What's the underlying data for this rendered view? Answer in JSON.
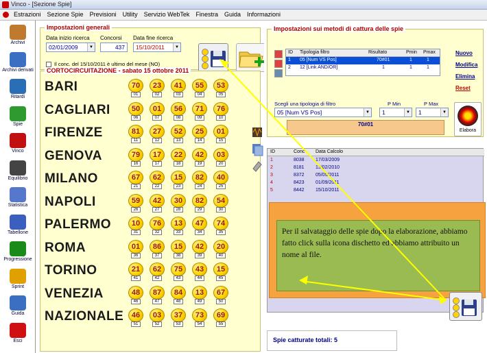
{
  "window": {
    "title": "Vinco - [Sezione Spie]"
  },
  "menu": [
    "Estrazioni",
    "Sezione Spie",
    "Previsioni",
    "Utility",
    "Servizio WebTek",
    "Finestra",
    "Guida",
    "Informazioni"
  ],
  "sidebar": [
    {
      "label": "Archivi",
      "icon": "pencil-icon",
      "color": "#c07a30"
    },
    {
      "label": "Archivi derivati",
      "icon": "document-icon",
      "color": "#3a6fc1"
    },
    {
      "label": "Ritardi",
      "icon": "clock-icon",
      "color": "#2a6fb5"
    },
    {
      "label": "Spie",
      "icon": "flashlight-icon",
      "color": "#2f9a2f"
    },
    {
      "label": "Vinco",
      "icon": "vinco-logo-icon",
      "color": "#c01010"
    },
    {
      "label": "Equilibrio",
      "icon": "scale-icon",
      "color": "#444444"
    },
    {
      "label": "Statistica",
      "icon": "chart-icon",
      "color": "#5577cc"
    },
    {
      "label": "Tabellone",
      "icon": "calendar-icon",
      "color": "#3a5fbf"
    },
    {
      "label": "Progressione",
      "icon": "dollar-icon",
      "color": "#1a8a1a"
    },
    {
      "label": "Sprint",
      "icon": "arrow-icon",
      "color": "#e0a000"
    },
    {
      "label": "Guida",
      "icon": "book-icon",
      "color": "#3a6fc1"
    },
    {
      "label": "Esci",
      "icon": "exit-icon",
      "color": "#d01010"
    }
  ],
  "general": {
    "title": "Impostazioni generali",
    "start_label": "Data inizio ricerca",
    "start_value": "02/01/2009",
    "conc_label": "Concorsi",
    "conc_value": "437",
    "end_label": "Data fine ricerca",
    "end_value": "15/10/2011",
    "checkbox_label": "Il conc. del 15/10/2011 è ultimo del mese (NO)"
  },
  "results": {
    "title": "CORTOCIRCUITAZIONE - sabato 15 ottobre 2011",
    "rows": [
      {
        "city": "BARI",
        "balls": [
          [
            70,
            "01"
          ],
          [
            23,
            "02"
          ],
          [
            41,
            "03"
          ],
          [
            55,
            "04"
          ],
          [
            53,
            "05"
          ]
        ]
      },
      {
        "city": "CAGLIARI",
        "balls": [
          [
            50,
            "06"
          ],
          [
            1,
            "07"
          ],
          [
            56,
            "08"
          ],
          [
            71,
            "09"
          ],
          [
            76,
            "10"
          ]
        ]
      },
      {
        "city": "FIRENZE",
        "balls": [
          [
            81,
            "11"
          ],
          [
            27,
            "12"
          ],
          [
            52,
            "13"
          ],
          [
            25,
            "14"
          ],
          [
            1,
            "15"
          ]
        ]
      },
      {
        "city": "GENOVA",
        "balls": [
          [
            79,
            "16"
          ],
          [
            17,
            "17"
          ],
          [
            22,
            "18"
          ],
          [
            42,
            "19"
          ],
          [
            3,
            "20"
          ]
        ]
      },
      {
        "city": "MILANO",
        "balls": [
          [
            67,
            "21"
          ],
          [
            62,
            "22"
          ],
          [
            15,
            "23"
          ],
          [
            82,
            "24"
          ],
          [
            40,
            "25"
          ]
        ]
      },
      {
        "city": "NAPOLI",
        "balls": [
          [
            59,
            "26"
          ],
          [
            42,
            "27"
          ],
          [
            30,
            "28"
          ],
          [
            82,
            "29"
          ],
          [
            54,
            "30"
          ]
        ]
      },
      {
        "city": "PALERMO",
        "balls": [
          [
            10,
            "31"
          ],
          [
            76,
            "32"
          ],
          [
            13,
            "33"
          ],
          [
            47,
            "34"
          ],
          [
            74,
            "35"
          ]
        ]
      },
      {
        "city": "ROMA",
        "balls": [
          [
            1,
            "36"
          ],
          [
            86,
            "37"
          ],
          [
            15,
            "38"
          ],
          [
            42,
            "39"
          ],
          [
            20,
            "40"
          ]
        ]
      },
      {
        "city": "TORINO",
        "balls": [
          [
            21,
            "41"
          ],
          [
            62,
            "42"
          ],
          [
            75,
            "43"
          ],
          [
            43,
            "44"
          ],
          [
            15,
            "45"
          ]
        ]
      },
      {
        "city": "VENEZIA",
        "balls": [
          [
            48,
            "46"
          ],
          [
            87,
            "47"
          ],
          [
            84,
            "48"
          ],
          [
            13,
            "49"
          ],
          [
            67,
            "50"
          ]
        ]
      },
      {
        "city": "NAZIONALE",
        "balls": [
          [
            46,
            "51"
          ],
          [
            3,
            "52"
          ],
          [
            37,
            "53"
          ],
          [
            73,
            "54"
          ],
          [
            69,
            "55"
          ]
        ]
      }
    ]
  },
  "methods": {
    "title": "Impostazioni sui metodi di cattura delle spie",
    "table_headers": [
      "ID",
      "Tipologia filtro",
      "Risultato",
      "Pmin",
      "Pmax"
    ],
    "table_rows": [
      [
        "1",
        "05 [Num VS Pos]",
        "70#01",
        "1",
        "1"
      ],
      [
        "2",
        "12 [Link AND/OR]",
        "1",
        "1",
        "1"
      ]
    ],
    "actions": [
      "Nuovo",
      "Modifica",
      "Elimina",
      "Reset"
    ],
    "choose_label": "Scegli una tipologia di filtro",
    "pmin_label": "P Min",
    "pmax_label": "P Max",
    "method_value": "05 [Num VS Pos]",
    "pmin_value": "1",
    "pmax_value": "1",
    "conc_display": "70#01",
    "elabora": "Elabora"
  },
  "captures": {
    "headers": [
      "ID",
      "Conc",
      "Data Calcolo"
    ],
    "rows": [
      [
        "1",
        "8038",
        "17/03/2009"
      ],
      [
        "2",
        "8181",
        "13/02/2010"
      ],
      [
        "3",
        "8372",
        "05/05/2011"
      ],
      [
        "4",
        "8423",
        "01/09/2011"
      ],
      [
        "5",
        "8442",
        "15/10/2011"
      ]
    ]
  },
  "totals": {
    "label": "Spie catturate totali: 5"
  },
  "note": {
    "text": "Per il salvataggio delle spie dopo la elaborazione, abbiamo fatto click sulla icona dischetto ed abbiamo attribuito un nome al file."
  },
  "colors": {
    "accent": "#b00000",
    "panel": "#ffffd0",
    "note": "#9aba52",
    "overlay": "#f5a23f",
    "arrow": "#ffff00"
  }
}
